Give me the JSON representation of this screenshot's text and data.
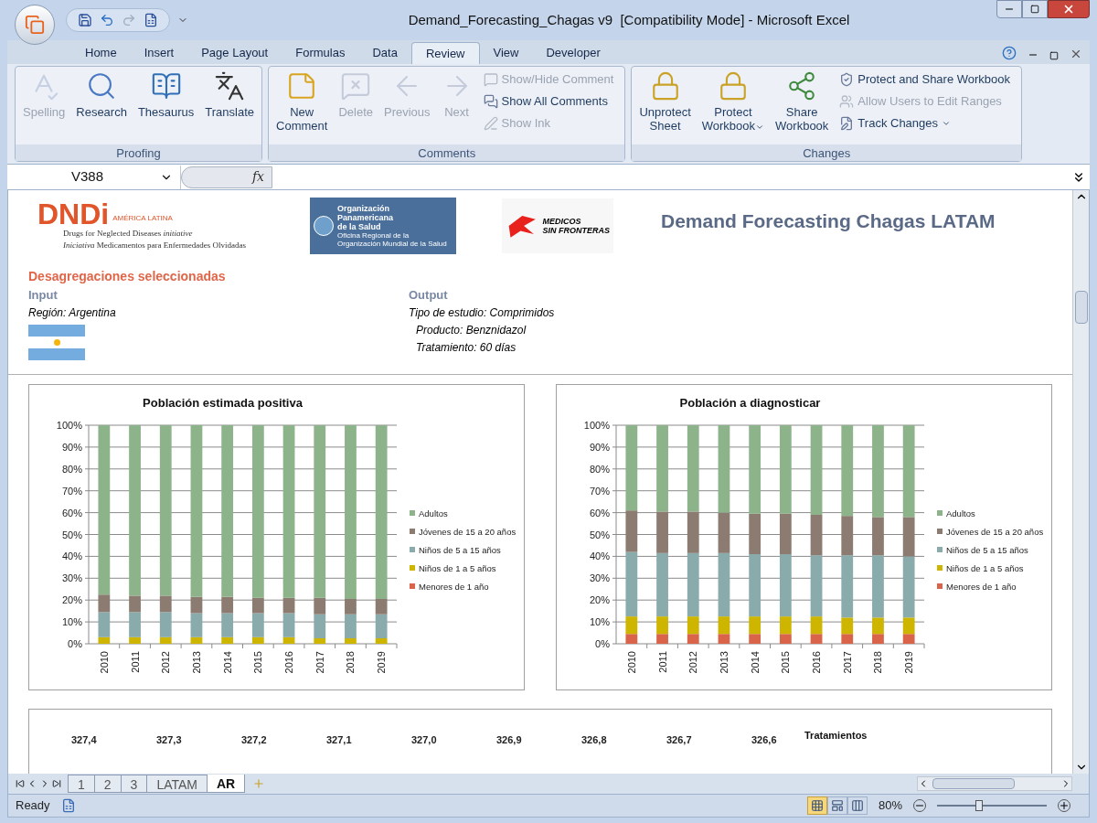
{
  "window": {
    "title": "Demand_Forecasting_Chagas v9  [Compatibility Mode] - Microsoft Excel"
  },
  "ribbon_tabs": [
    {
      "label": "Home",
      "selected": false
    },
    {
      "label": "Insert",
      "selected": false
    },
    {
      "label": "Page Layout",
      "selected": false
    },
    {
      "label": "Formulas",
      "selected": false
    },
    {
      "label": "Data",
      "selected": false
    },
    {
      "label": "Review",
      "selected": true
    },
    {
      "label": "View",
      "selected": false
    },
    {
      "label": "Developer",
      "selected": false
    }
  ],
  "ribbon_groups": [
    {
      "label": "Proofing",
      "large_buttons": [
        {
          "label": "Spelling",
          "disabled": true,
          "dropdown": false
        },
        {
          "label": "Research",
          "disabled": false,
          "dropdown": false
        },
        {
          "label": "Thesaurus",
          "disabled": false,
          "dropdown": false
        },
        {
          "label": "Translate",
          "disabled": false,
          "dropdown": false
        }
      ]
    },
    {
      "label": "Comments",
      "large_buttons": [
        {
          "label": "New\nComment",
          "disabled": false,
          "dropdown": false
        },
        {
          "label": "Delete",
          "disabled": true,
          "dropdown": false
        },
        {
          "label": "Previous",
          "disabled": true,
          "dropdown": false
        },
        {
          "label": "Next",
          "disabled": true,
          "dropdown": false
        }
      ],
      "small_buttons": [
        {
          "label": "Show/Hide Comment",
          "disabled": true,
          "dropdown": false
        },
        {
          "label": "Show All Comments",
          "disabled": false,
          "dropdown": false
        },
        {
          "label": "Show Ink",
          "disabled": true,
          "dropdown": false
        }
      ]
    },
    {
      "label": "Changes",
      "large_buttons": [
        {
          "label": "Unprotect\nSheet",
          "disabled": false,
          "dropdown": false
        },
        {
          "label": "Protect\nWorkbook",
          "disabled": false,
          "dropdown": true
        },
        {
          "label": "Share\nWorkbook",
          "disabled": false,
          "dropdown": false
        }
      ],
      "small_buttons": [
        {
          "label": "Protect and Share Workbook",
          "disabled": false,
          "dropdown": false
        },
        {
          "label": "Allow Users to Edit Ranges",
          "disabled": true,
          "dropdown": false
        },
        {
          "label": "Track Changes",
          "disabled": false,
          "dropdown": true
        }
      ]
    }
  ],
  "formula_bar": {
    "name_box": "V388",
    "function_button": "fx"
  },
  "sheet": {
    "logos": {
      "dndi": {
        "name": "DNDi",
        "region": "AMÉRICA LATINA",
        "line_1": "Drugs for Neglected Diseases *initiative*",
        "line_2": "*Iniciativa* Medicamentos para Enfermedades Olvidadas"
      },
      "ops": {
        "name": [
          "Organización",
          "Panamericana",
          "de la Salud"
        ],
        "sub": [
          "Oficina Regional de la",
          "Organización Mundial de la Salud"
        ]
      },
      "msf": {
        "name": [
          "MEDICOS",
          "SIN FRONTERAS"
        ]
      }
    },
    "title": "Demand Forecasting Chagas LATAM",
    "section_title": "Desagregaciones seleccionadas",
    "input": {
      "heading": "Input",
      "lines": [
        "Región: Argentina"
      ]
    },
    "output": {
      "heading": "Output",
      "lines": [
        "Tipo de estudio: Comprimidos",
        "Producto: Benznidazol",
        "Tratamiento: 60 días"
      ]
    },
    "charts": [
      {
        "chart_data": {
          "type": "bar",
          "title": "Población estimada positiva",
          "stacked": true,
          "grid": true,
          "legend": "right",
          "orientation": "vertical",
          "categories": [
            "2010",
            "2011",
            "2012",
            "2013",
            "2014",
            "2015",
            "2016",
            "2017",
            "2018",
            "2019"
          ],
          "ylim": [
            0,
            100
          ],
          "yticks": [
            {
              "value": 0,
              "label": "0%"
            },
            {
              "value": 10,
              "label": "10%"
            },
            {
              "value": 20,
              "label": "20%"
            },
            {
              "value": 30,
              "label": "30%"
            },
            {
              "value": 40,
              "label": "40%"
            },
            {
              "value": 50,
              "label": "50%"
            },
            {
              "value": 60,
              "label": "60%"
            },
            {
              "value": 70,
              "label": "70%"
            },
            {
              "value": 80,
              "label": "80%"
            },
            {
              "value": 90,
              "label": "90%"
            },
            {
              "value": 100,
              "label": "100%"
            }
          ],
          "series": [
            {
              "name": "Menores de 1 año",
              "color": "#d9644a",
              "values": [
                0,
                0,
                0,
                0,
                0,
                0,
                0,
                0,
                0,
                0
              ]
            },
            {
              "name": "Niños de 1 a 5 años",
              "color": "#cdb500",
              "values": [
                3,
                3,
                3,
                3,
                3,
                3,
                3,
                2.5,
                2.5,
                2.5
              ]
            },
            {
              "name": "Niños de 5 a 15 años",
              "color": "#8aabab",
              "values": [
                11.5,
                11.5,
                11.5,
                11,
                11,
                11,
                11,
                11,
                11,
                11
              ]
            },
            {
              "name": "Jóvenes de 15 a 20 años",
              "color": "#8c7b70",
              "values": [
                8,
                7.5,
                7.5,
                7.5,
                7.5,
                7,
                7,
                7.5,
                7,
                7
              ]
            },
            {
              "name": "Adultos",
              "color": "#8db38b",
              "values": [
                77.5,
                78,
                78,
                78.5,
                78.5,
                79,
                79,
                79,
                79.5,
                79.5
              ]
            }
          ]
        }
      },
      {
        "chart_data": {
          "type": "bar",
          "title": "Población a diagnosticar",
          "stacked": true,
          "grid": true,
          "legend": "right",
          "orientation": "vertical",
          "categories": [
            "2010",
            "2011",
            "2012",
            "2013",
            "2014",
            "2015",
            "2016",
            "2017",
            "2018",
            "2019"
          ],
          "ylim": [
            0,
            100
          ],
          "yticks": [
            {
              "value": 0,
              "label": "0%"
            },
            {
              "value": 10,
              "label": "10%"
            },
            {
              "value": 20,
              "label": "20%"
            },
            {
              "value": 30,
              "label": "30%"
            },
            {
              "value": 40,
              "label": "40%"
            },
            {
              "value": 50,
              "label": "50%"
            },
            {
              "value": 60,
              "label": "60%"
            },
            {
              "value": 70,
              "label": "70%"
            },
            {
              "value": 80,
              "label": "80%"
            },
            {
              "value": 90,
              "label": "90%"
            },
            {
              "value": 100,
              "label": "100%"
            }
          ],
          "series": [
            {
              "name": "Menores de 1 año",
              "color": "#d9644a",
              "values": [
                4.5,
                4.5,
                4.5,
                4.5,
                4.5,
                4.5,
                4.5,
                4.5,
                4.5,
                4.5
              ]
            },
            {
              "name": "Niños de 1 a 5 años",
              "color": "#cdb500",
              "values": [
                8,
                8,
                8,
                8,
                8,
                8,
                8,
                7.5,
                7.5,
                7.5
              ]
            },
            {
              "name": "Niños de 5 a 15 años",
              "color": "#8aabab",
              "values": [
                29.5,
                29,
                29,
                29,
                28.5,
                28.5,
                28,
                28.5,
                28.5,
                28
              ]
            },
            {
              "name": "Jóvenes de 15 a 20 años",
              "color": "#8c7b70",
              "values": [
                19,
                19,
                19,
                18.5,
                18.5,
                18.5,
                18.5,
                18,
                17.5,
                18
              ]
            },
            {
              "name": "Adultos",
              "color": "#8db38b",
              "values": [
                39,
                39.5,
                39.5,
                40,
                40.5,
                40.5,
                41,
                41.5,
                42,
                42
              ]
            }
          ]
        }
      }
    ],
    "bottom_panel": {
      "values": [
        "327,4",
        "327,3",
        "327,2",
        "327,1",
        "327,0",
        "326,9",
        "326,8",
        "326,7",
        "326,6"
      ],
      "legend": "Tratamientos"
    }
  },
  "sheet_tabs": [
    {
      "label": "1",
      "selected": false
    },
    {
      "label": "2",
      "selected": false
    },
    {
      "label": "3",
      "selected": false
    },
    {
      "label": "LATAM",
      "selected": false
    },
    {
      "label": "AR",
      "selected": true
    }
  ],
  "status_bar": {
    "status": "Ready",
    "views": [
      {
        "kind": "normal",
        "selected": true
      },
      {
        "kind": "page_layout",
        "selected": false
      },
      {
        "kind": "page_break",
        "selected": false
      }
    ],
    "zoom": "80%",
    "zoom_slider": {
      "level": 0.38
    }
  }
}
